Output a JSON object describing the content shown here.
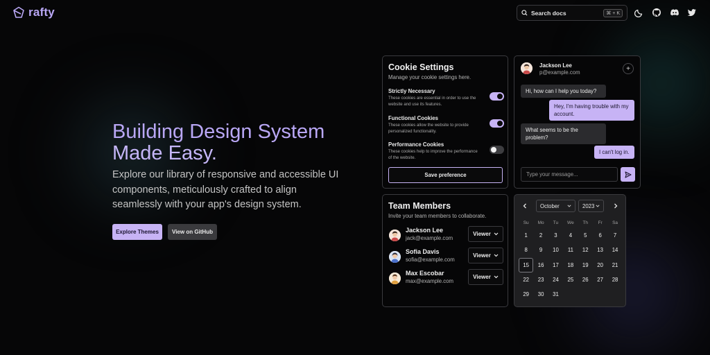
{
  "header": {
    "logo_text": "rafty",
    "search_label": "Search docs",
    "search_shortcut": "⌘ + K",
    "icons": [
      "moon-icon",
      "github-icon",
      "discord-icon",
      "twitter-icon"
    ]
  },
  "hero": {
    "title_line1": "Building Design System",
    "title_line2": "Made Easy.",
    "subtitle": "Explore our library of responsive and accessible UI components, meticulously crafted to align seamlessly with your app's design system.",
    "primary_button": "Explore Themes",
    "secondary_button": "View on GitHub"
  },
  "cookie_settings": {
    "title": "Cookie Settings",
    "description": "Manage your cookie settings here.",
    "items": [
      {
        "name": "Strictly Necessary",
        "text": "These cookies are essential in order to use the website and use its features.",
        "enabled": true
      },
      {
        "name": "Functional Cookies",
        "text": "These cookies allow the website to provide personalized functionality.",
        "enabled": true
      },
      {
        "name": "Performance Cookies",
        "text": "These cookies help to improve the performance of the website.",
        "enabled": false
      }
    ],
    "save_button": "Save preference"
  },
  "chat": {
    "user_name": "Jackson Lee",
    "user_email": "p@example.com",
    "messages": [
      {
        "from": "them",
        "text": "Hi, how can I help you today?"
      },
      {
        "from": "me",
        "text": "Hey, I'm having trouble with my account."
      },
      {
        "from": "them",
        "text": "What seems to be the problem?"
      },
      {
        "from": "me",
        "text": "I can't log in."
      }
    ],
    "input_placeholder": "Type your message..."
  },
  "team": {
    "title": "Team Members",
    "description": "Invite your team members to collaborate.",
    "members": [
      {
        "name": "Jackson Lee",
        "email": "jack@example.com",
        "role": "Viewer"
      },
      {
        "name": "Sofia Davis",
        "email": "sofia@example.com",
        "role": "Viewer"
      },
      {
        "name": "Max Escobar",
        "email": "max@example.com",
        "role": "Viewer"
      }
    ]
  },
  "calendar": {
    "month": "October",
    "year": "2023",
    "weekdays": [
      "Su",
      "Mo",
      "Tu",
      "We",
      "Th",
      "Fr",
      "Sa"
    ],
    "weeks": [
      [
        "1",
        "2",
        "3",
        "4",
        "5",
        "6",
        "7"
      ],
      [
        "8",
        "9",
        "10",
        "11",
        "12",
        "13",
        "14"
      ],
      [
        "15",
        "16",
        "17",
        "18",
        "19",
        "20",
        "21"
      ],
      [
        "22",
        "23",
        "24",
        "25",
        "26",
        "27",
        "28"
      ],
      [
        "29",
        "30",
        "31",
        "",
        "",
        "",
        ""
      ]
    ],
    "selected_day": "15"
  },
  "colors": {
    "accent": "#c7b3f5",
    "background": "#060607",
    "border": "#3a3a3e"
  }
}
